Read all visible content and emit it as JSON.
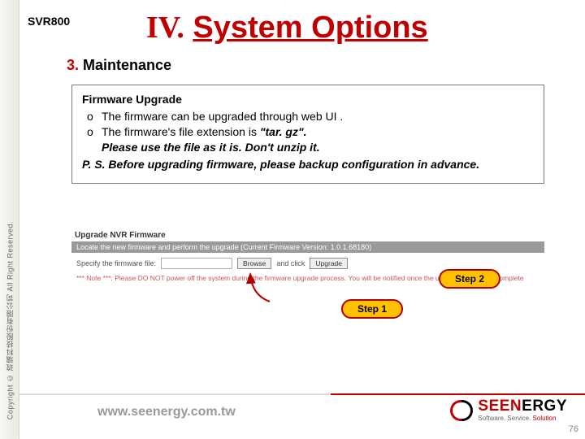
{
  "rail": {
    "copyright": "Copyright © 琉璃科技股份有限公司 All Right Reserved."
  },
  "header": {
    "product": "SVR800"
  },
  "title": {
    "number": "IV.",
    "text": "System Options"
  },
  "section": {
    "number": "3.",
    "text": "Maintenance"
  },
  "box": {
    "heading": "Firmware Upgrade",
    "bullets": {
      "b0": "The firmware can be upgraded through web UI .",
      "b1_pre": "The firmware's file extension is ",
      "b1_em": "\"tar. gz\".",
      "b1_line2": "Please use the file as it is. Don't unzip it."
    },
    "ps": "P. S. Before upgrading firmware, please backup configuration in advance."
  },
  "panel": {
    "title": "Upgrade NVR Firmware",
    "subtitle": "Locate the new firmware and perform the upgrade (Current Firmware Version: 1.0.1.68180)",
    "row_label": "Specify the firmware file:",
    "browse": "Browse",
    "mid": "and click",
    "upgrade": "Upgrade",
    "note": "*** Note ***: Please DO NOT power off the system during the firmware upgrade process. You will be notified once the upgrade process is complete"
  },
  "callouts": {
    "step1": "Step 1",
    "step2": "Step 2"
  },
  "footer": {
    "url": "www.seenergy.com.tw",
    "brand_a": "SEEN",
    "brand_b": "ERGY",
    "tagline_a": "Software. Service. ",
    "tagline_b": "Solution",
    "page": "76"
  }
}
